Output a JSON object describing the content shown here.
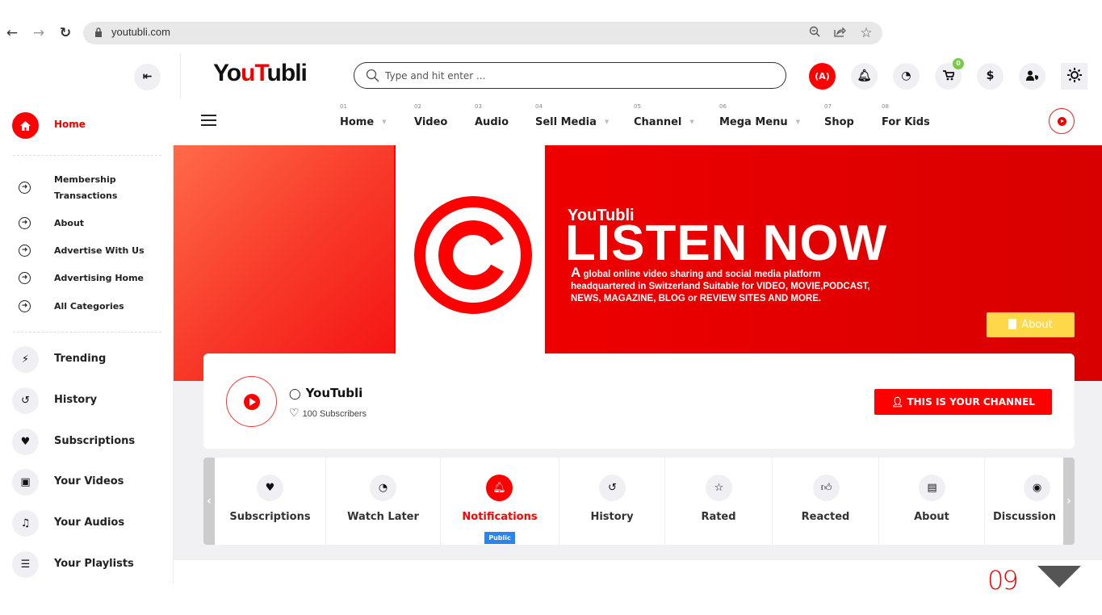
{
  "browser": {
    "url": "youtubli.com",
    "icons": [
      "back-arrow",
      "forward-arrow",
      "reload",
      "lock",
      "zoom-out",
      "share",
      "bookmark-star"
    ]
  },
  "header": {
    "logo": {
      "part1": "Yo",
      "part2": "u",
      "part3": "T",
      "part4": "ubli"
    },
    "search_placeholder": "Type and hit enter ...",
    "icons": [
      "live-broadcast",
      "bell",
      "clock",
      "cart",
      "dollar",
      "user-shield",
      "sun-settings"
    ],
    "live_label": "(A)",
    "cart_badge": "0"
  },
  "top_nav": {
    "items": [
      {
        "num": "01",
        "label": "Home",
        "dropdown": true
      },
      {
        "num": "02",
        "label": "Video",
        "dropdown": false
      },
      {
        "num": "03",
        "label": "Audio",
        "dropdown": false
      },
      {
        "num": "04",
        "label": "Sell Media",
        "dropdown": true
      },
      {
        "num": "05",
        "label": "Channel",
        "dropdown": true
      },
      {
        "num": "06",
        "label": "Mega Menu",
        "dropdown": true
      },
      {
        "num": "07",
        "label": "Shop",
        "dropdown": false
      },
      {
        "num": "08",
        "label": "For Kids",
        "dropdown": false
      }
    ]
  },
  "sidebar": {
    "home": "Home",
    "links": [
      {
        "label": "Membership Transactions"
      },
      {
        "label": "About"
      },
      {
        "label": "Advertise With Us"
      },
      {
        "label": "Advertising Home"
      },
      {
        "label": "All Categories"
      }
    ],
    "main": [
      {
        "label": "Trending",
        "icon": "bolt"
      },
      {
        "label": "History",
        "icon": "history"
      },
      {
        "label": "Subscriptions",
        "icon": "heart"
      },
      {
        "label": "Your Videos",
        "icon": "video-camera"
      },
      {
        "label": "Your Audios",
        "icon": "music-note"
      },
      {
        "label": "Your Playlists",
        "icon": "list"
      }
    ]
  },
  "banner": {
    "brand": "YouTubli",
    "title": "LISTEN NOW",
    "desc_cap": "A",
    "desc_rest": " global online video sharing and social media platform headquartered in Switzerland Suitable for VIDEO, MOVIE,PODCAST, NEWS, MAGAZINE, BLOG or REVIEW SITES AND MORE.",
    "about_button": "About"
  },
  "channel": {
    "name": "YouTubli",
    "subscribers": "100 Subscribers",
    "owner_button": "THIS IS YOUR CHANNEL"
  },
  "channel_tabs": [
    {
      "label": "Subscriptions",
      "icon": "heart"
    },
    {
      "label": "Watch Later",
      "icon": "clock"
    },
    {
      "label": "Notifications",
      "icon": "bell",
      "active": true,
      "badge": "Public"
    },
    {
      "label": "History",
      "icon": "history"
    },
    {
      "label": "Rated",
      "icon": "star-half"
    },
    {
      "label": "Reacted",
      "icon": "thumbs-up"
    },
    {
      "label": "About",
      "icon": "scroll"
    },
    {
      "label": "Discussion",
      "icon": "comments"
    }
  ],
  "pagination": {
    "current": "09"
  },
  "colors": {
    "accent": "#ff0000",
    "badge_green": "#7bc94a",
    "public_badge": "#2b84ee",
    "about_yellow": "#ffd84a"
  }
}
